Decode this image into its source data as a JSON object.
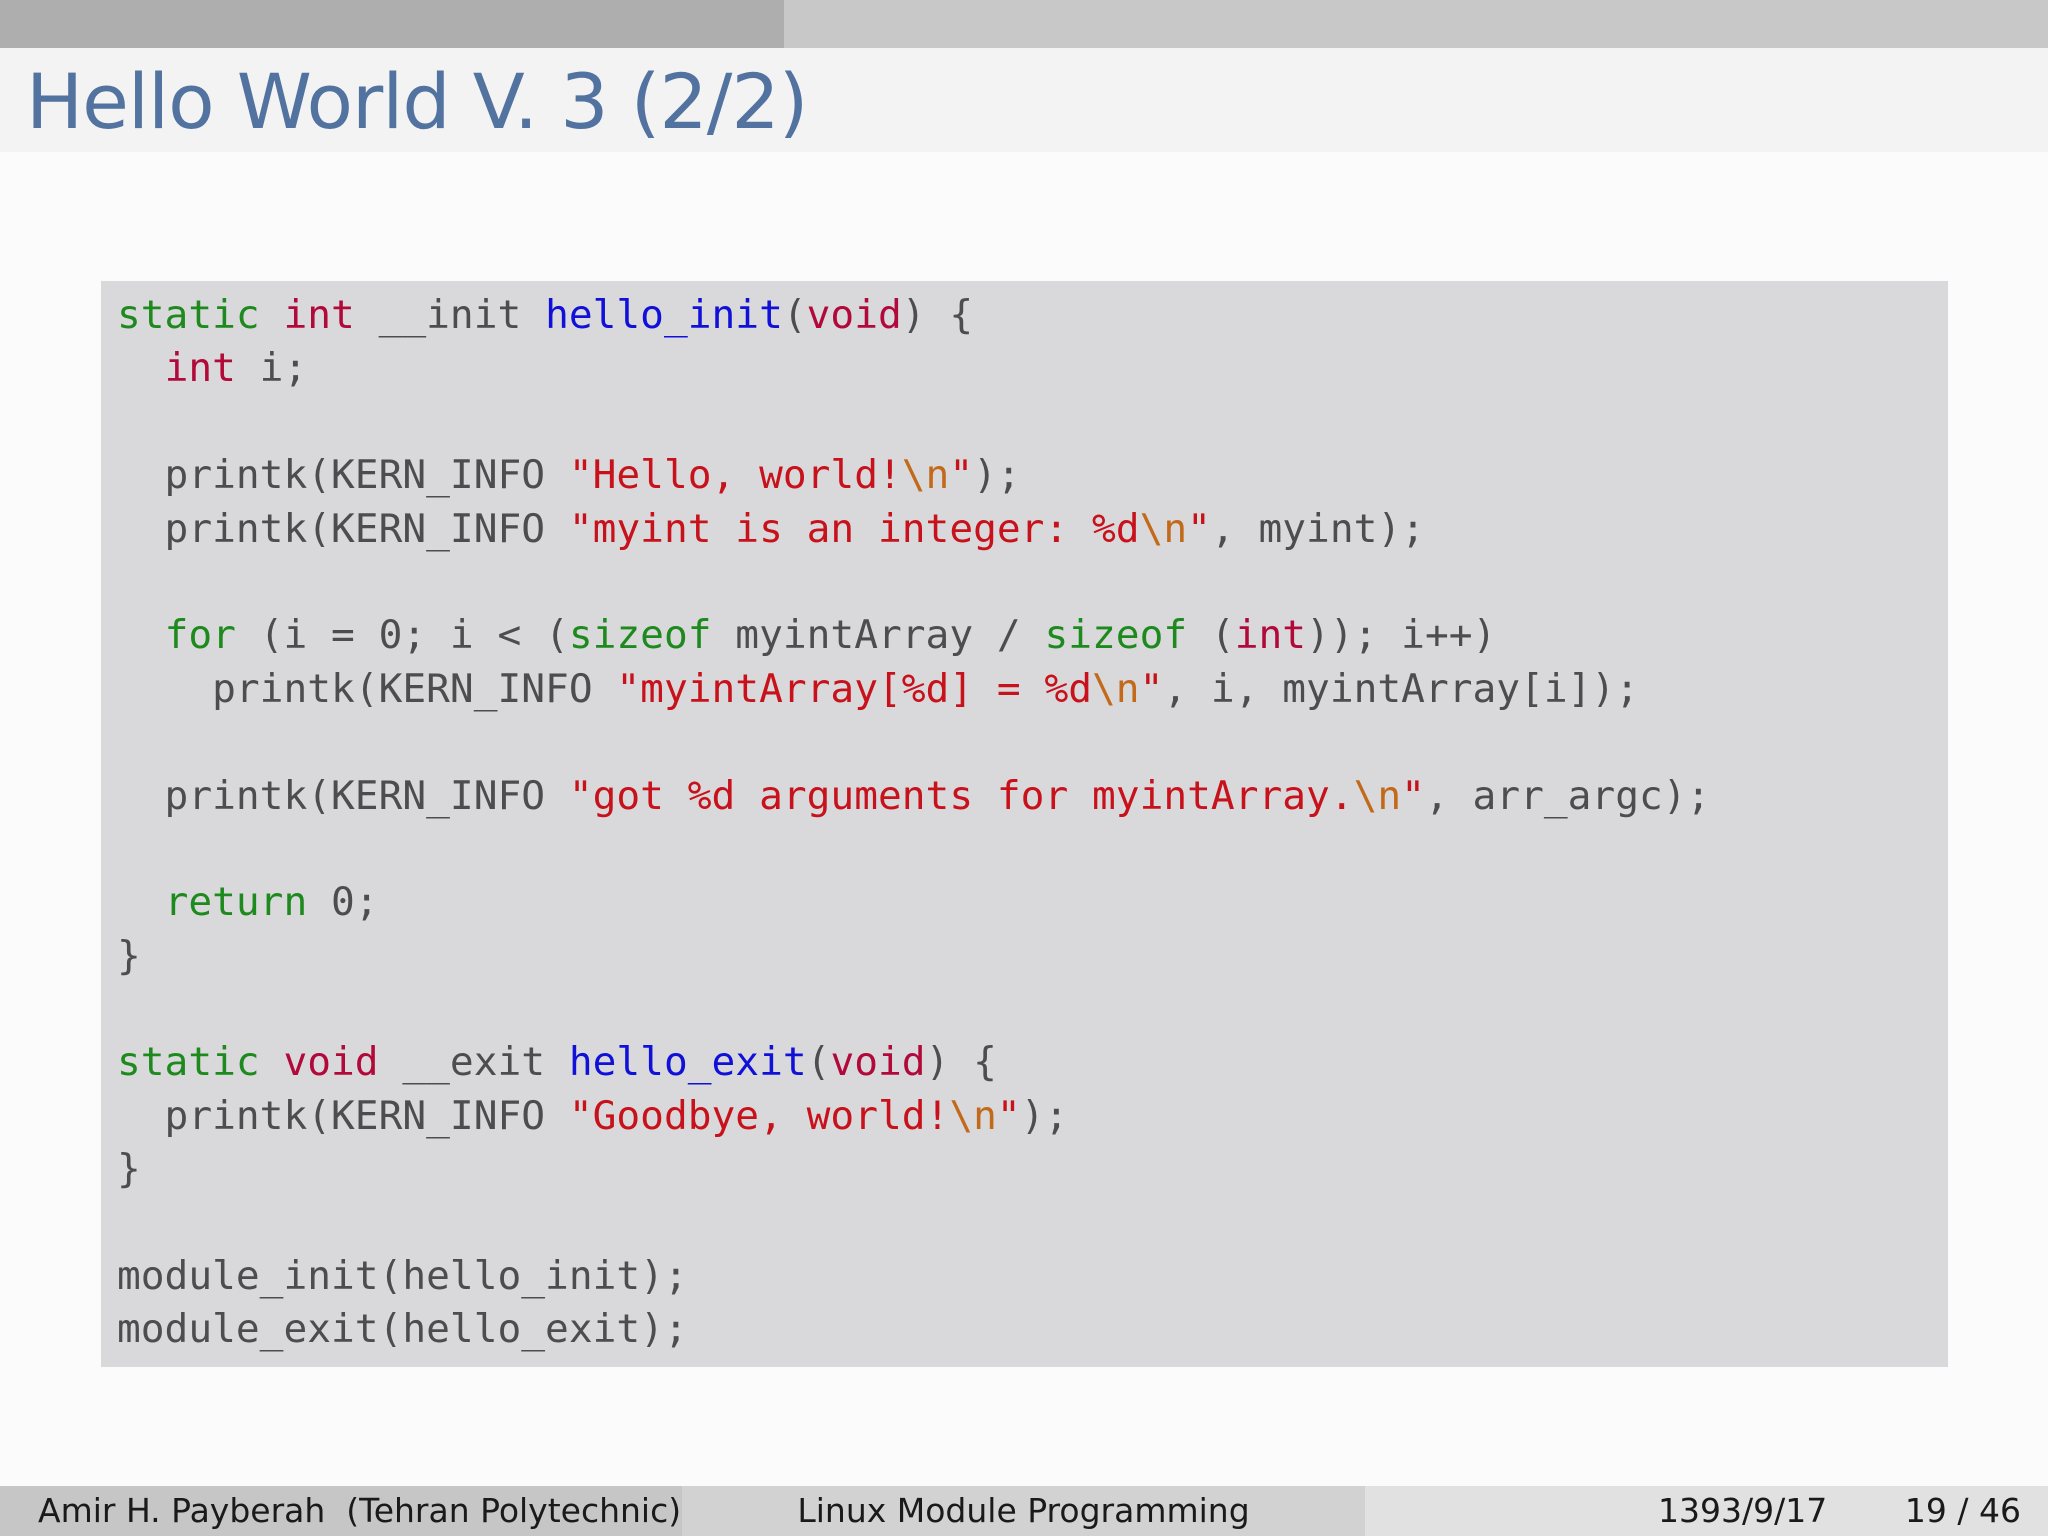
{
  "progress": {
    "fraction": 0.383
  },
  "title": "Hello World V. 3 (2/2)",
  "colors": {
    "title": "#52729f",
    "code_background": "#d9d9dc",
    "keyword": "#1e8a1e",
    "type": "#b10a3a",
    "function": "#1010d8",
    "string": "#c8121b",
    "escape": "#c2691a",
    "plain": "#4d4d4d"
  },
  "code_lines": [
    [
      {
        "t": "kw",
        "s": "static"
      },
      {
        "t": "p",
        "s": " "
      },
      {
        "t": "type",
        "s": "int"
      },
      {
        "t": "p",
        "s": " __init "
      },
      {
        "t": "fn",
        "s": "hello_init"
      },
      {
        "t": "p",
        "s": "("
      },
      {
        "t": "type",
        "s": "void"
      },
      {
        "t": "p",
        "s": ") {"
      }
    ],
    [
      {
        "t": "p",
        "s": "  "
      },
      {
        "t": "type",
        "s": "int"
      },
      {
        "t": "p",
        "s": " i;"
      }
    ],
    [],
    [
      {
        "t": "p",
        "s": "  printk(KERN_INFO "
      },
      {
        "t": "str",
        "s": "\"Hello, world!"
      },
      {
        "t": "esc",
        "s": "\\n"
      },
      {
        "t": "str",
        "s": "\""
      },
      {
        "t": "p",
        "s": ");"
      }
    ],
    [
      {
        "t": "p",
        "s": "  printk(KERN_INFO "
      },
      {
        "t": "str",
        "s": "\"myint is an integer: %d"
      },
      {
        "t": "esc",
        "s": "\\n"
      },
      {
        "t": "str",
        "s": "\""
      },
      {
        "t": "p",
        "s": ", myint);"
      }
    ],
    [],
    [
      {
        "t": "p",
        "s": "  "
      },
      {
        "t": "kw",
        "s": "for"
      },
      {
        "t": "p",
        "s": " (i = 0; i < ("
      },
      {
        "t": "kw",
        "s": "sizeof"
      },
      {
        "t": "p",
        "s": " myintArray / "
      },
      {
        "t": "kw",
        "s": "sizeof"
      },
      {
        "t": "p",
        "s": " ("
      },
      {
        "t": "type",
        "s": "int"
      },
      {
        "t": "p",
        "s": ")); i++)"
      }
    ],
    [
      {
        "t": "p",
        "s": "    printk(KERN_INFO "
      },
      {
        "t": "str",
        "s": "\"myintArray[%d] = %d"
      },
      {
        "t": "esc",
        "s": "\\n"
      },
      {
        "t": "str",
        "s": "\""
      },
      {
        "t": "p",
        "s": ", i, myintArray[i]);"
      }
    ],
    [],
    [
      {
        "t": "p",
        "s": "  printk(KERN_INFO "
      },
      {
        "t": "str",
        "s": "\"got %d arguments for myintArray."
      },
      {
        "t": "esc",
        "s": "\\n"
      },
      {
        "t": "str",
        "s": "\""
      },
      {
        "t": "p",
        "s": ", arr_argc);"
      }
    ],
    [],
    [
      {
        "t": "p",
        "s": "  "
      },
      {
        "t": "kw",
        "s": "return"
      },
      {
        "t": "p",
        "s": " 0;"
      }
    ],
    [
      {
        "t": "p",
        "s": "}"
      }
    ],
    [],
    [
      {
        "t": "kw",
        "s": "static"
      },
      {
        "t": "p",
        "s": " "
      },
      {
        "t": "type",
        "s": "void"
      },
      {
        "t": "p",
        "s": " __exit "
      },
      {
        "t": "fn",
        "s": "hello_exit"
      },
      {
        "t": "p",
        "s": "("
      },
      {
        "t": "type",
        "s": "void"
      },
      {
        "t": "p",
        "s": ") {"
      }
    ],
    [
      {
        "t": "p",
        "s": "  printk(KERN_INFO "
      },
      {
        "t": "str",
        "s": "\"Goodbye, world!"
      },
      {
        "t": "esc",
        "s": "\\n"
      },
      {
        "t": "str",
        "s": "\""
      },
      {
        "t": "p",
        "s": ");"
      }
    ],
    [
      {
        "t": "p",
        "s": "}"
      }
    ],
    [],
    [
      {
        "t": "p",
        "s": "module_init(hello_init);"
      }
    ],
    [
      {
        "t": "p",
        "s": "module_exit(hello_exit);"
      }
    ]
  ],
  "footer": {
    "author": "Amir H. Payberah  (Tehran Polytechnic)",
    "talk_title": "Linux Module Programming",
    "date": "1393/9/17",
    "page": "19 / 46"
  }
}
